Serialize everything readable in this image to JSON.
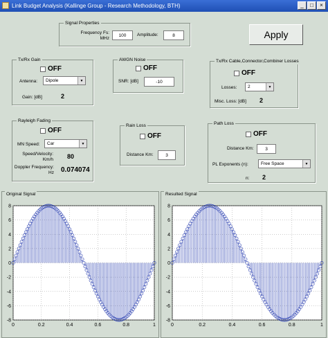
{
  "window": {
    "title": "Link Budget Analysis (Kallinge Group - Research Methodology, BTH)",
    "buttons": [
      "_",
      "□",
      "×"
    ]
  },
  "signal_properties": {
    "title": "Signal Properties",
    "freq_label_1": "Frequency Fs:",
    "freq_label_2": "MHz",
    "freq_value": "100",
    "amp_label": "Amplitude:",
    "amp_value": "8"
  },
  "apply_label": "Apply",
  "txrx_gain": {
    "title": "Tx/Rx Gain",
    "off": "OFF",
    "antenna_label": "Antenna:",
    "antenna_value": "Dipole",
    "gain_label": "Gain: [dB]",
    "gain_value": "2"
  },
  "awgn": {
    "title": "AWGN Noise",
    "off": "OFF",
    "snr_label": "SNR: [dB]",
    "snr_value": "-10"
  },
  "cable_losses": {
    "title": "Tx/Rx Cable,Connector,Combiner Losses",
    "off": "OFF",
    "losses_label": "Losses:",
    "losses_value": "2",
    "misc_label": "Misc. Loss: [dB]",
    "misc_value": "2"
  },
  "rayleigh": {
    "title": "Rayleigh Fading",
    "off": "OFF",
    "ms_label": "MN Speed:",
    "ms_value": "Car",
    "speed_label_1": "Speed/Velocity:",
    "speed_label_2": "Km/h",
    "speed_value": "80",
    "doppler_label_1": "Doppler Frequency:",
    "doppler_label_2": "Hz",
    "doppler_value": "0.074074"
  },
  "rain_loss": {
    "title": "Rain Loss",
    "off": "OFF",
    "dist_label": "Distance Km:",
    "dist_value": "3"
  },
  "path_loss": {
    "title": "Path Loss",
    "off": "OFF",
    "dist_label": "Distance Km:",
    "dist_value": "3",
    "pl_label": "PL Exponents (n):",
    "pl_value": "Free Space",
    "n_label": "n:",
    "n_value": "2"
  },
  "chart_data": [
    {
      "type": "stem",
      "title": "Original Signal",
      "xlim": [
        0,
        1
      ],
      "ylim": [
        -8,
        8
      ],
      "xticks": [
        "0",
        "0.2",
        "0.4",
        "0.6",
        "0.8",
        "1"
      ],
      "yticks": [
        "8",
        "6",
        "4",
        "2",
        "0",
        "-2",
        "-4",
        "-6",
        "-8"
      ],
      "grid": true,
      "signal": {
        "function": "sine",
        "amplitude": 8,
        "frequency_cycles": 1,
        "samples": 101
      }
    },
    {
      "type": "stem",
      "title": "Resulted Signal",
      "xlim": [
        0,
        1
      ],
      "ylim": [
        -8,
        8
      ],
      "xticks": [
        "0",
        "0.2",
        "0.4",
        "0.6",
        "0.8",
        "1"
      ],
      "yticks": [
        "8",
        "6",
        "4",
        "2",
        "0",
        "-2",
        "-4",
        "-6",
        "-8"
      ],
      "grid": true,
      "signal": {
        "function": "sine",
        "amplitude": 8,
        "frequency_cycles": 1,
        "samples": 101
      }
    }
  ],
  "colors": {
    "titlebar": "#2a5fc8",
    "background": "#d4ddd4",
    "stem": "#2a3fb0"
  }
}
